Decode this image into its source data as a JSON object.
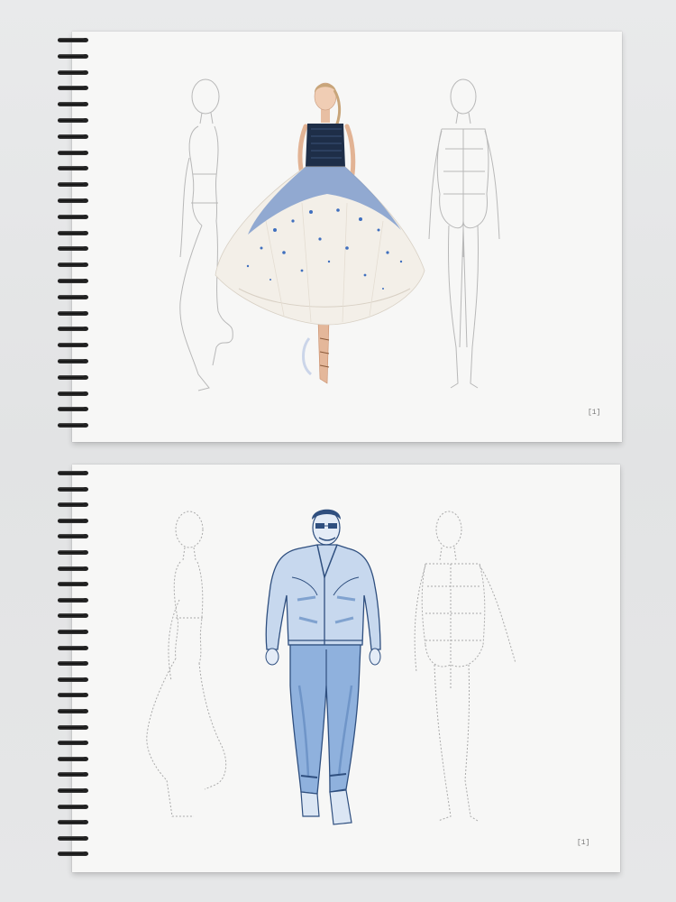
{
  "image": {
    "description_tags": [
      "sketchbook-top",
      "sketchbook-bottom"
    ],
    "background_color": "#e6e7e8",
    "paper_color": "#f7f7f6",
    "spiral_color": "#1a1a1a"
  },
  "top_book": {
    "page_number": "[1]",
    "figures": [
      "croquis-side-outline",
      "woman-in-blue-sequin-gown",
      "croquis-back-outline"
    ],
    "gown_colors": {
      "bodice": "#1e2e48",
      "sequins": "#3f6fbe",
      "skirt": "#f3efe8"
    }
  },
  "bottom_book": {
    "page_number": "[1]",
    "figures": [
      "croquis-side-outline",
      "man-in-denim-outfit",
      "croquis-back-outline"
    ],
    "denim_colors": {
      "main": "#6f95c8",
      "dark": "#2f4f7f",
      "light": "#c7d8ee"
    }
  }
}
